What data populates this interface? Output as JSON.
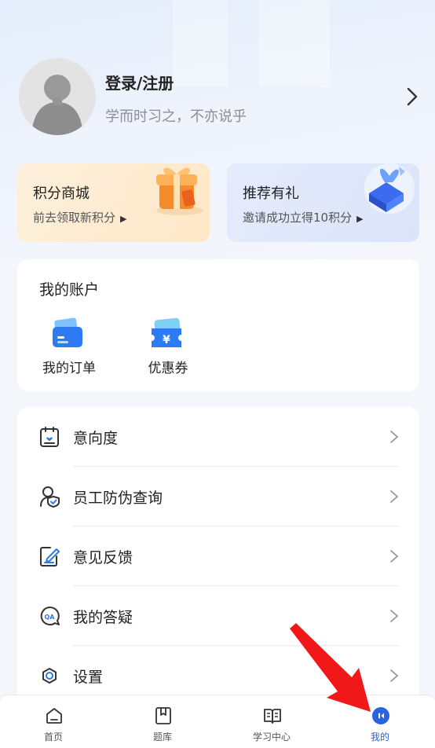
{
  "profile": {
    "login_label": "登录/注册",
    "slogan": "学而时习之，不亦说乎"
  },
  "promos": {
    "points": {
      "title": "积分商城",
      "subtitle": "前去领取新积分",
      "icon": "gift-box-icon"
    },
    "refer": {
      "title": "推荐有礼",
      "subtitle": "邀请成功立得10积分",
      "icon": "gift-ribbon-icon"
    }
  },
  "account": {
    "title": "我的账户",
    "items": [
      {
        "label": "我的订单",
        "icon": "wallet-card-icon"
      },
      {
        "label": "优惠券",
        "icon": "yen-coupon-icon"
      }
    ]
  },
  "menu": [
    {
      "label": "意向度",
      "icon": "calendar-heart-icon"
    },
    {
      "label": "员工防伪查询",
      "icon": "user-shield-icon"
    },
    {
      "label": "意见反馈",
      "icon": "edit-feedback-icon"
    },
    {
      "label": "我的答疑",
      "icon": "qa-bubble-icon"
    },
    {
      "label": "设置",
      "icon": "gear-icon"
    }
  ],
  "tabbar": {
    "tabs": [
      {
        "label": "首页",
        "icon": "home-icon"
      },
      {
        "label": "题库",
        "icon": "bookmark-book-icon"
      },
      {
        "label": "学习中心",
        "icon": "open-book-icon"
      },
      {
        "label": "我的",
        "icon": "profile-dot-icon"
      }
    ],
    "active_index": 3
  },
  "colors": {
    "accent": "#2b62e0",
    "annotation_arrow": "#f01818",
    "points_card": "#fde9cc",
    "refer_card": "#dfe7fb"
  }
}
